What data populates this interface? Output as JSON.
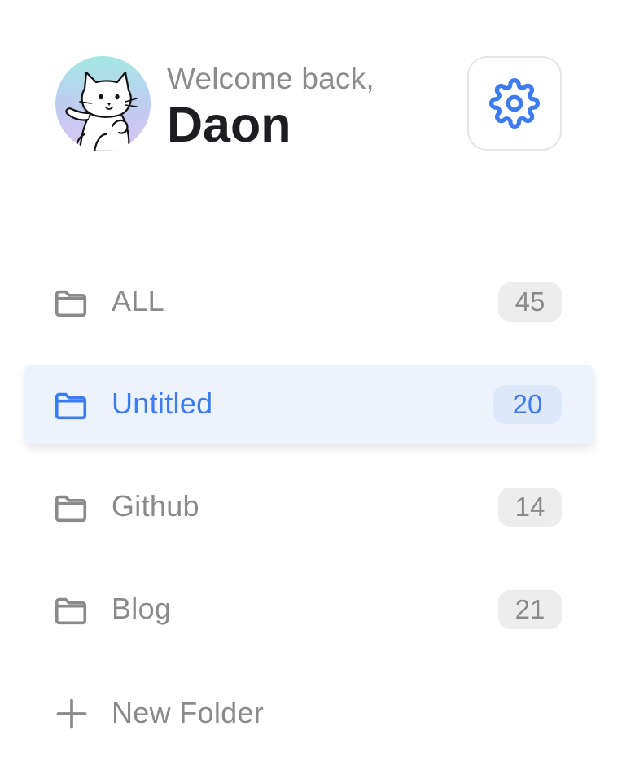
{
  "header": {
    "welcome_text": "Welcome back,",
    "username": "Daon",
    "avatar_icon": "cat-avatar-icon",
    "settings_icon": "gear-icon"
  },
  "folders": [
    {
      "label": "ALL",
      "count": "45",
      "active": false
    },
    {
      "label": "Untitled",
      "count": "20",
      "active": true
    },
    {
      "label": "Github",
      "count": "14",
      "active": false
    },
    {
      "label": "Blog",
      "count": "21",
      "active": false
    }
  ],
  "new_folder": {
    "label": "New Folder",
    "icon": "plus-icon"
  },
  "colors": {
    "accent": "#3d7bf0",
    "active_background": "#edf3fd",
    "muted_text": "#8a8a8a",
    "badge_background": "#ededed"
  }
}
